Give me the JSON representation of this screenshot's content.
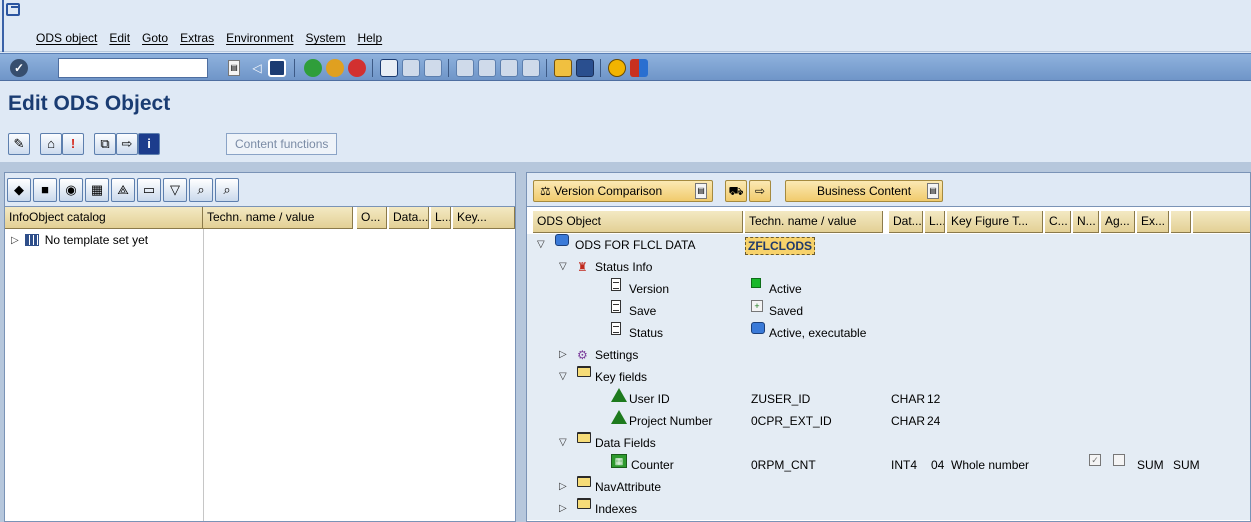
{
  "menubar": {
    "items": [
      "ODS object",
      "Edit",
      "Goto",
      "Extras",
      "Environment",
      "System",
      "Help"
    ]
  },
  "standard_toolbar": {
    "command_field_value": ""
  },
  "page_title": "Edit ODS Object",
  "app_toolbar": {
    "content_functions_label": "Content functions"
  },
  "left_pane": {
    "columns": [
      "InfoObject catalog",
      "Techn. name / value",
      "O...",
      "Data...",
      "L...",
      "Key..."
    ],
    "tree": [
      {
        "label": "No template set yet"
      }
    ]
  },
  "right_pane": {
    "toolbar": {
      "version_comparison_label": "Version Comparison",
      "business_content_label": "Business Content"
    },
    "columns": [
      "ODS Object",
      "Techn. name / value",
      "Dat...",
      "L...",
      "Key Figure T...",
      "C...",
      "N...",
      "Ag...",
      "Ex..."
    ],
    "rows": [
      {
        "level": 0,
        "expander": "▽",
        "icon": "cube-icon",
        "label": "ODS FOR FLCL DATA",
        "tech": "ZFLCLODS"
      },
      {
        "level": 1,
        "expander": "▽",
        "icon": "status-icon",
        "label": "Status Info"
      },
      {
        "level": 2,
        "icon": "doc-icon",
        "label": "Version",
        "value_icon": "green-square-icon",
        "value": "Active"
      },
      {
        "level": 2,
        "icon": "doc-icon",
        "label": "Save",
        "value_icon": "saved-icon",
        "value": "Saved"
      },
      {
        "level": 2,
        "icon": "doc-icon",
        "label": "Status",
        "value_icon": "cube-icon",
        "value": "Active, executable"
      },
      {
        "level": 1,
        "expander": "▷",
        "icon": "settings-icon",
        "label": "Settings"
      },
      {
        "level": 1,
        "expander": "▽",
        "icon": "folder-icon",
        "label": "Key fields"
      },
      {
        "level": 2,
        "icon": "key-char-icon",
        "label": "User ID",
        "tech": "ZUSER_ID",
        "type": "CHAR",
        "length": "12"
      },
      {
        "level": 2,
        "icon": "key-char-icon",
        "label": "Project Number",
        "tech": "0CPR_EXT_ID",
        "type": "CHAR",
        "length": "24"
      },
      {
        "level": 1,
        "expander": "▽",
        "icon": "folder-icon",
        "label": "Data Fields"
      },
      {
        "level": 2,
        "icon": "key-figure-icon",
        "label": "Counter",
        "tech": "0RPM_CNT",
        "type": "INT4",
        "length": "04",
        "kf_type": "Whole number",
        "agg1": "SUM",
        "agg2": "SUM"
      },
      {
        "level": 1,
        "expander": "▷",
        "icon": "folder-icon",
        "label": "NavAttribute"
      },
      {
        "level": 1,
        "expander": "▷",
        "icon": "folder-icon",
        "label": "Indexes"
      }
    ]
  }
}
